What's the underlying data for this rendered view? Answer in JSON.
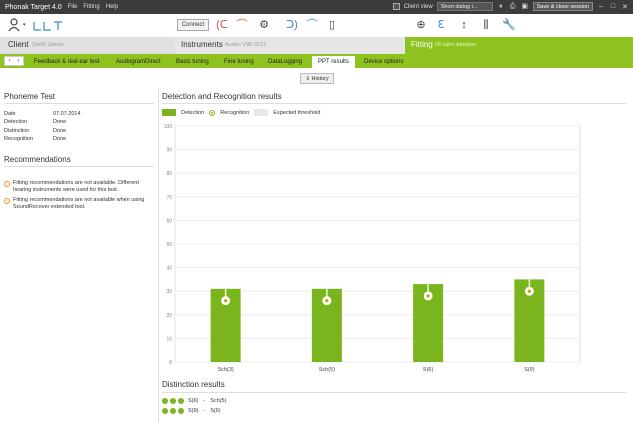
{
  "titlebar": {
    "app_title": "Phonak Target 4.0",
    "menus": [
      "File",
      "Fitting",
      "Help"
    ],
    "client_view_label": "Client view",
    "dialog_select": "Short dialog i...",
    "save_close_label": "Save & close session"
  },
  "toolbar": {
    "connect_label": "Connect"
  },
  "info": {
    "client_label": "Client",
    "client_name": "Smith James",
    "instruments_label": "Instruments",
    "instruments_name": "Audéo V90-312T",
    "fitting_label": "Fitting",
    "fitting_sub": "Of calm situation"
  },
  "tabs": [
    {
      "label": "Feedback & real ear test"
    },
    {
      "label": "AudiogramDirect"
    },
    {
      "label": "Basic tuning"
    },
    {
      "label": "Fine tuning"
    },
    {
      "label": "DataLogging"
    },
    {
      "label": "PPT results"
    },
    {
      "label": "Device options"
    }
  ],
  "history_label": "History",
  "phoneme": {
    "title": "Phoneme Test",
    "rows": [
      {
        "key": "Date",
        "value": "07.07.2014"
      },
      {
        "key": "Detection",
        "value": "Done"
      },
      {
        "key": "Distinction",
        "value": "Done"
      },
      {
        "key": "Recognition",
        "value": "Done"
      }
    ]
  },
  "recommendations": {
    "title": "Recommendations",
    "items": [
      "Fitting recommendations are not available. Different hearing instruments were used for this test.",
      "Fitting recommendations are not available when using SoundRecover extended tool."
    ]
  },
  "results": {
    "title": "Detection and Recognition results",
    "legend": {
      "detection": "Detection",
      "recognition": "Recognition",
      "expected": "Expected threshold"
    }
  },
  "chart_data": {
    "type": "bar",
    "categories": [
      "Sch(3)",
      "Sch(5)",
      "S(6)",
      "S(9)"
    ],
    "series": [
      {
        "name": "Detection",
        "values": [
          31,
          31,
          33,
          35
        ]
      },
      {
        "name": "Recognition",
        "values": [
          26,
          26,
          28,
          30
        ]
      }
    ],
    "yticks": [
      0,
      10,
      20,
      30,
      40,
      50,
      60,
      70,
      80,
      90,
      100
    ],
    "ylim": [
      0,
      100
    ],
    "colors": {
      "detection": "#7ab51d",
      "recognition": "#c8a200"
    }
  },
  "distinction": {
    "title": "Distinction results",
    "rows": [
      {
        "a": "S(6)",
        "sep": "-",
        "b": "Sch(5)"
      },
      {
        "a": "S(9)",
        "sep": "-",
        "b": "S(6)"
      }
    ]
  }
}
